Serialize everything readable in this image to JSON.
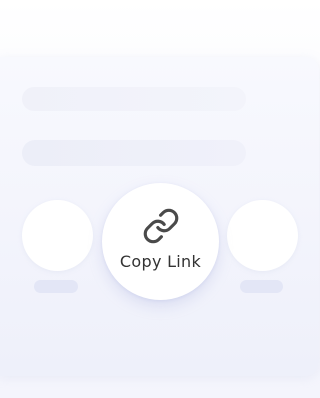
{
  "share_sheet": {
    "primary_action": {
      "label": "Copy Link",
      "icon": "link-icon"
    },
    "other_actions": [
      {
        "icon": "placeholder-slot"
      },
      {
        "icon": "placeholder-slot"
      }
    ]
  },
  "colors": {
    "background": "#f4f5fc",
    "skeleton": "#eeeff8",
    "caption_placeholder": "#e3e6f6",
    "button_bg": "#ffffff",
    "text": "#333333"
  }
}
